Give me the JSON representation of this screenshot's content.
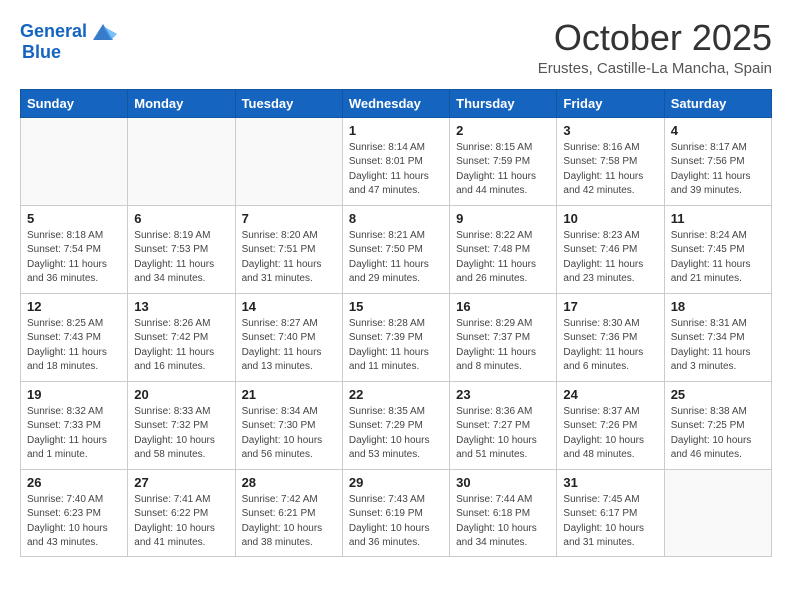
{
  "header": {
    "logo_line1": "General",
    "logo_line2": "Blue",
    "month": "October 2025",
    "location": "Erustes, Castille-La Mancha, Spain"
  },
  "days_of_week": [
    "Sunday",
    "Monday",
    "Tuesday",
    "Wednesday",
    "Thursday",
    "Friday",
    "Saturday"
  ],
  "weeks": [
    [
      {
        "day": "",
        "info": ""
      },
      {
        "day": "",
        "info": ""
      },
      {
        "day": "",
        "info": ""
      },
      {
        "day": "1",
        "info": "Sunrise: 8:14 AM\nSunset: 8:01 PM\nDaylight: 11 hours and 47 minutes."
      },
      {
        "day": "2",
        "info": "Sunrise: 8:15 AM\nSunset: 7:59 PM\nDaylight: 11 hours and 44 minutes."
      },
      {
        "day": "3",
        "info": "Sunrise: 8:16 AM\nSunset: 7:58 PM\nDaylight: 11 hours and 42 minutes."
      },
      {
        "day": "4",
        "info": "Sunrise: 8:17 AM\nSunset: 7:56 PM\nDaylight: 11 hours and 39 minutes."
      }
    ],
    [
      {
        "day": "5",
        "info": "Sunrise: 8:18 AM\nSunset: 7:54 PM\nDaylight: 11 hours and 36 minutes."
      },
      {
        "day": "6",
        "info": "Sunrise: 8:19 AM\nSunset: 7:53 PM\nDaylight: 11 hours and 34 minutes."
      },
      {
        "day": "7",
        "info": "Sunrise: 8:20 AM\nSunset: 7:51 PM\nDaylight: 11 hours and 31 minutes."
      },
      {
        "day": "8",
        "info": "Sunrise: 8:21 AM\nSunset: 7:50 PM\nDaylight: 11 hours and 29 minutes."
      },
      {
        "day": "9",
        "info": "Sunrise: 8:22 AM\nSunset: 7:48 PM\nDaylight: 11 hours and 26 minutes."
      },
      {
        "day": "10",
        "info": "Sunrise: 8:23 AM\nSunset: 7:46 PM\nDaylight: 11 hours and 23 minutes."
      },
      {
        "day": "11",
        "info": "Sunrise: 8:24 AM\nSunset: 7:45 PM\nDaylight: 11 hours and 21 minutes."
      }
    ],
    [
      {
        "day": "12",
        "info": "Sunrise: 8:25 AM\nSunset: 7:43 PM\nDaylight: 11 hours and 18 minutes."
      },
      {
        "day": "13",
        "info": "Sunrise: 8:26 AM\nSunset: 7:42 PM\nDaylight: 11 hours and 16 minutes."
      },
      {
        "day": "14",
        "info": "Sunrise: 8:27 AM\nSunset: 7:40 PM\nDaylight: 11 hours and 13 minutes."
      },
      {
        "day": "15",
        "info": "Sunrise: 8:28 AM\nSunset: 7:39 PM\nDaylight: 11 hours and 11 minutes."
      },
      {
        "day": "16",
        "info": "Sunrise: 8:29 AM\nSunset: 7:37 PM\nDaylight: 11 hours and 8 minutes."
      },
      {
        "day": "17",
        "info": "Sunrise: 8:30 AM\nSunset: 7:36 PM\nDaylight: 11 hours and 6 minutes."
      },
      {
        "day": "18",
        "info": "Sunrise: 8:31 AM\nSunset: 7:34 PM\nDaylight: 11 hours and 3 minutes."
      }
    ],
    [
      {
        "day": "19",
        "info": "Sunrise: 8:32 AM\nSunset: 7:33 PM\nDaylight: 11 hours and 1 minute."
      },
      {
        "day": "20",
        "info": "Sunrise: 8:33 AM\nSunset: 7:32 PM\nDaylight: 10 hours and 58 minutes."
      },
      {
        "day": "21",
        "info": "Sunrise: 8:34 AM\nSunset: 7:30 PM\nDaylight: 10 hours and 56 minutes."
      },
      {
        "day": "22",
        "info": "Sunrise: 8:35 AM\nSunset: 7:29 PM\nDaylight: 10 hours and 53 minutes."
      },
      {
        "day": "23",
        "info": "Sunrise: 8:36 AM\nSunset: 7:27 PM\nDaylight: 10 hours and 51 minutes."
      },
      {
        "day": "24",
        "info": "Sunrise: 8:37 AM\nSunset: 7:26 PM\nDaylight: 10 hours and 48 minutes."
      },
      {
        "day": "25",
        "info": "Sunrise: 8:38 AM\nSunset: 7:25 PM\nDaylight: 10 hours and 46 minutes."
      }
    ],
    [
      {
        "day": "26",
        "info": "Sunrise: 7:40 AM\nSunset: 6:23 PM\nDaylight: 10 hours and 43 minutes."
      },
      {
        "day": "27",
        "info": "Sunrise: 7:41 AM\nSunset: 6:22 PM\nDaylight: 10 hours and 41 minutes."
      },
      {
        "day": "28",
        "info": "Sunrise: 7:42 AM\nSunset: 6:21 PM\nDaylight: 10 hours and 38 minutes."
      },
      {
        "day": "29",
        "info": "Sunrise: 7:43 AM\nSunset: 6:19 PM\nDaylight: 10 hours and 36 minutes."
      },
      {
        "day": "30",
        "info": "Sunrise: 7:44 AM\nSunset: 6:18 PM\nDaylight: 10 hours and 34 minutes."
      },
      {
        "day": "31",
        "info": "Sunrise: 7:45 AM\nSunset: 6:17 PM\nDaylight: 10 hours and 31 minutes."
      },
      {
        "day": "",
        "info": ""
      }
    ]
  ]
}
